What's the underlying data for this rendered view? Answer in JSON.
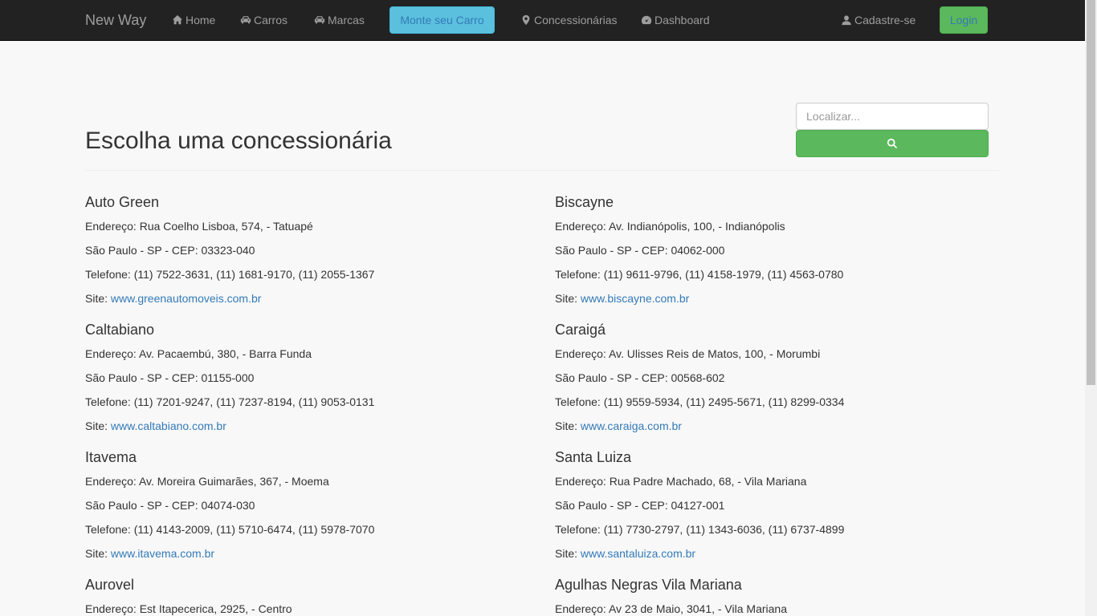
{
  "navbar": {
    "brand": "New Way",
    "items": [
      {
        "label": "Home",
        "icon": "home-icon"
      },
      {
        "label": "Carros",
        "icon": "car-icon"
      },
      {
        "label": "Marcas",
        "icon": "car-icon"
      },
      {
        "label": "Monte seu Carro"
      },
      {
        "label": "Concessionárias",
        "icon": "map-marker-icon"
      },
      {
        "label": "Dashboard",
        "icon": "dashboard-icon"
      }
    ],
    "signup": {
      "label": "Cadastre-se",
      "icon": "user-icon"
    },
    "login": "Login"
  },
  "page": {
    "title": "Escolha uma concessionária",
    "search": {
      "placeholder": "Localizar...",
      "value": ""
    }
  },
  "dealers": [
    {
      "name": "Auto Green",
      "address": "Endereço: Rua Coelho Lisboa, 574, - Tatuapé",
      "city": "São Paulo - SP - CEP: 03323-040",
      "phones": "Telefone: (11) 7522-3631, (11) 1681-9170, (11) 2055-1367",
      "site_label": "Site:",
      "site": "www.greenautomoveis.com.br"
    },
    {
      "name": "Biscayne",
      "address": "Endereço: Av. Indianópolis, 100, - Indianópolis",
      "city": "São Paulo - SP - CEP: 04062-000",
      "phones": "Telefone: (11) 9611-9796, (11) 4158-1979, (11) 4563-0780",
      "site_label": "Site:",
      "site": "www.biscayne.com.br"
    },
    {
      "name": "Caltabiano",
      "address": "Endereço: Av. Pacaembú, 380, - Barra Funda",
      "city": "São Paulo - SP - CEP: 01155-000",
      "phones": "Telefone: (11) 7201-9247, (11) 7237-8194, (11) 9053-0131",
      "site_label": "Site:",
      "site": "www.caltabiano.com.br"
    },
    {
      "name": "Caraigá",
      "address": "Endereço: Av. Ulisses Reis de Matos, 100, - Morumbi",
      "city": "São Paulo - SP - CEP: 00568-602",
      "phones": "Telefone: (11) 9559-5934, (11) 2495-5671, (11) 8299-0334",
      "site_label": "Site:",
      "site": "www.caraiga.com.br"
    },
    {
      "name": "Itavema",
      "address": "Endereço: Av. Moreira Guimarães, 367, - Moema",
      "city": "São Paulo - SP - CEP: 04074-030",
      "phones": "Telefone: (11) 4143-2009, (11) 5710-6474, (11) 5978-7070",
      "site_label": "Site:",
      "site": "www.itavema.com.br"
    },
    {
      "name": "Santa Luiza",
      "address": "Endereço: Rua Padre Machado, 68, - Vila Mariana",
      "city": "São Paulo - SP - CEP: 04127-001",
      "phones": "Telefone: (11) 7730-2797, (11) 1343-6036, (11) 6737-4899",
      "site_label": "Site:",
      "site": "www.santaluiza.com.br"
    },
    {
      "name": "Aurovel",
      "address": "Endereço: Est Itapecerica, 2925, - Centro"
    },
    {
      "name": "Agulhas Negras Vila Mariana",
      "address": "Endereço: Av 23 de Maio, 3041, - Vila Mariana"
    }
  ],
  "colors": {
    "navbar": "#222222",
    "link": "#337ab7",
    "success": "#5cb85c",
    "info": "#5bc0de"
  }
}
